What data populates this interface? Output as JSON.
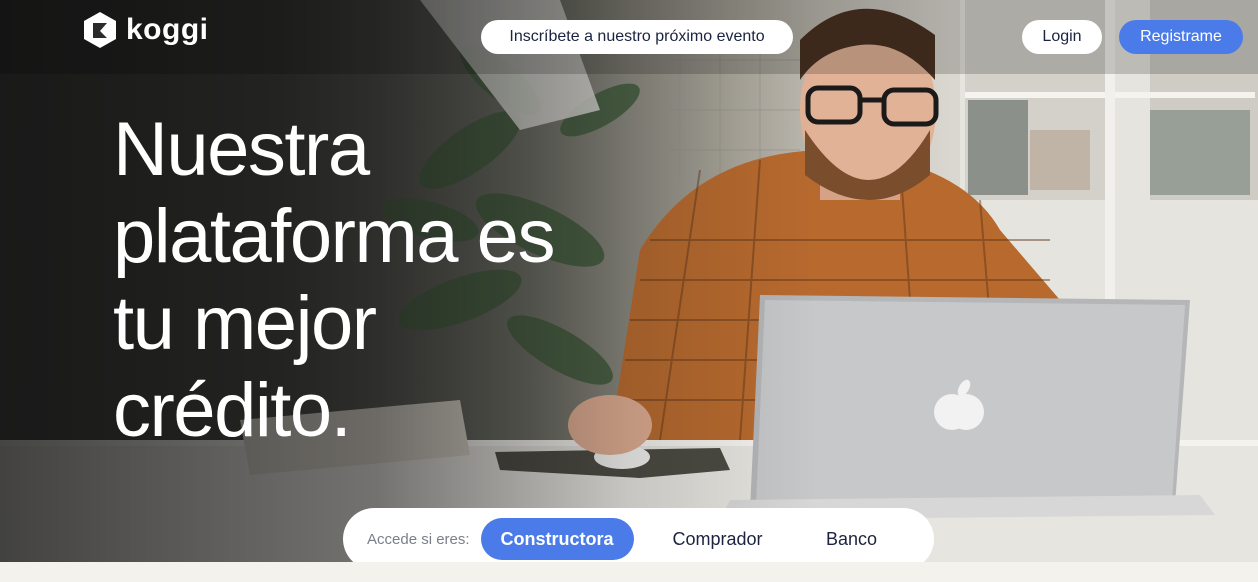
{
  "header": {
    "logo_text": "koggi",
    "event_label": "Inscríbete a nuestro próximo evento",
    "login_label": "Login",
    "register_label": "Registrame"
  },
  "hero": {
    "title_lines": [
      "Nuestra",
      "plataforma es",
      "tu mejor",
      "crédito."
    ]
  },
  "access": {
    "label": "Accede si eres:",
    "roles": [
      {
        "label": "Constructora",
        "active": true
      },
      {
        "label": "Comprador",
        "active": false
      },
      {
        "label": "Banco",
        "active": false
      }
    ]
  },
  "colors": {
    "accent": "#4b7be8",
    "text_dark": "#1b2340",
    "white": "#ffffff"
  },
  "icons": {
    "logo": "koggi-logo-icon",
    "laptop_brand": "apple-logo-icon"
  }
}
